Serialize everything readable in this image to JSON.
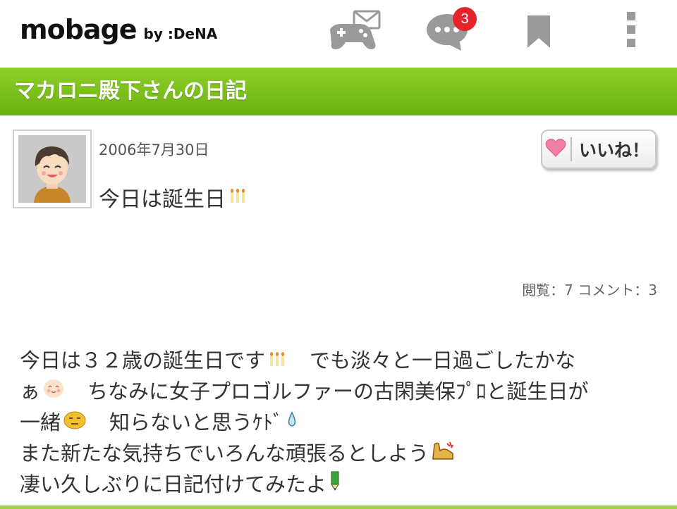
{
  "header": {
    "logo_main": "mobage",
    "logo_by": "by :DeNA",
    "messages_badge": "3",
    "icons": [
      "game-mail-icon",
      "chat-icon",
      "bookmark-icon",
      "more-vert-icon"
    ]
  },
  "colors": {
    "accent_green": "#7abf1a",
    "badge_red": "#e4232b"
  },
  "page": {
    "title": "マカロニ殿下さんの日記"
  },
  "entry": {
    "date": "2006年7月30日",
    "title": "今日は誕生日",
    "like_label": "いいね！",
    "stats": "閲覧：7 コメント：3",
    "lines": [
      [
        "今日は３２歳の誕生日です",
        "　でも淡々と一日過ごしたかな"
      ],
      [
        "ぁ",
        "　ちなみに女子プロゴルファーの古閑美保ﾌﾟﾛと誕生日が"
      ],
      [
        "一緒",
        "　知らないと思うｹﾄﾞ"
      ],
      [
        "また新たな気持ちでいろんな頑張るとしよう"
      ],
      [
        "凄い久しぶりに日記付けてみたよ"
      ]
    ]
  }
}
